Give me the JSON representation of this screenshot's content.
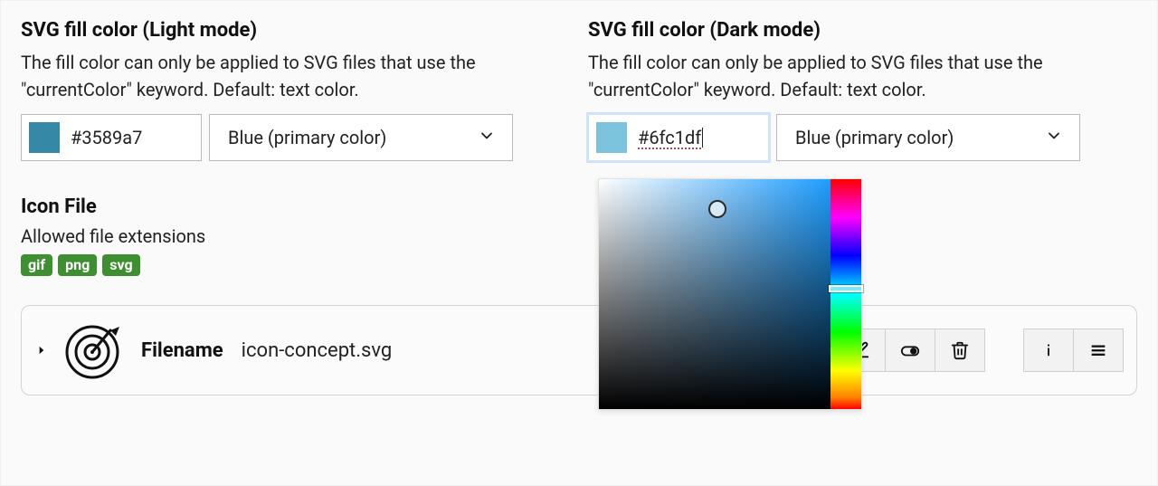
{
  "light": {
    "title": "SVG fill color (Light mode)",
    "description": "The fill color can only be applied to SVG files that use the \"currentColor\" keyword. Default: text color.",
    "hex": "#3589a7",
    "select_label": "Blue (primary color)",
    "swatch_color": "#3589a7"
  },
  "dark": {
    "title": "SVG fill color (Dark mode)",
    "description": "The fill color can only be applied to SVG files that use the \"currentColor\" keyword. Default: text color.",
    "hex": "#6fc1df",
    "select_label": "Blue (primary color)",
    "swatch_color": "#6fc1df"
  },
  "icon_file": {
    "title": "Icon File",
    "allowed_label": "Allowed file extensions",
    "extensions": [
      "gif",
      "png",
      "svg"
    ]
  },
  "file_row": {
    "filename_label": "Filename",
    "filename_value": "icon-concept.svg"
  },
  "picker": {
    "base_hue_color": "#1f9eff"
  }
}
